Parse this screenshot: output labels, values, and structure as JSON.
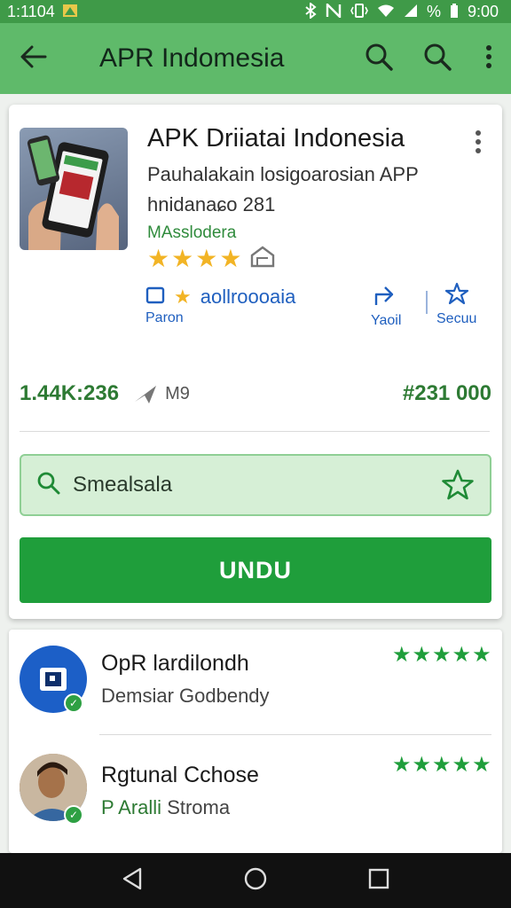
{
  "status_bar": {
    "time_left": "1:1104",
    "time_right": "9:00",
    "battery_text": "%"
  },
  "app_bar": {
    "title": "APR Indomesia"
  },
  "app": {
    "name": "APK Driiatai Indonesia",
    "description": "Pauhalakain losigoarosian APP",
    "subtitle": "hnidanaɕo 281",
    "developer": "MAsslodera",
    "rating_stars": 4,
    "meta_chip": "aollroooaia",
    "meta_under": "Paron",
    "share_label": "Yaoil",
    "save_label": "Secuu"
  },
  "stats": {
    "size": "1.44K:236",
    "unit": "M9",
    "price": "#231 000"
  },
  "search": {
    "placeholder": "Smealsala"
  },
  "download": {
    "label": "UNDU"
  },
  "reviews": [
    {
      "name": "OpR lardilondh",
      "sub": "Demsiar Godbendy",
      "stars": "★★★★★"
    },
    {
      "name": "Rgtunal Cchose",
      "sub_accent": "P Aralli",
      "sub_rest": " Stroma",
      "stars": "★★★★★"
    }
  ],
  "colors": {
    "app_bar": "#5fba6a",
    "status_bar": "#3f9a48",
    "primary_green": "#1f9e3b",
    "search_bg": "#d6efd6",
    "link_blue": "#1f5fbf",
    "star_gold": "#f2b425"
  },
  "icons": {
    "back": "back-arrow-icon",
    "search": "search-icon",
    "more": "more-vert-icon",
    "wishlist": "wishlist-icon",
    "share": "share-icon",
    "save": "save-icon",
    "favorite": "star-outline-icon",
    "nav_back": "nav-back-icon",
    "nav_home": "nav-home-icon",
    "nav_recents": "nav-recents-icon"
  }
}
